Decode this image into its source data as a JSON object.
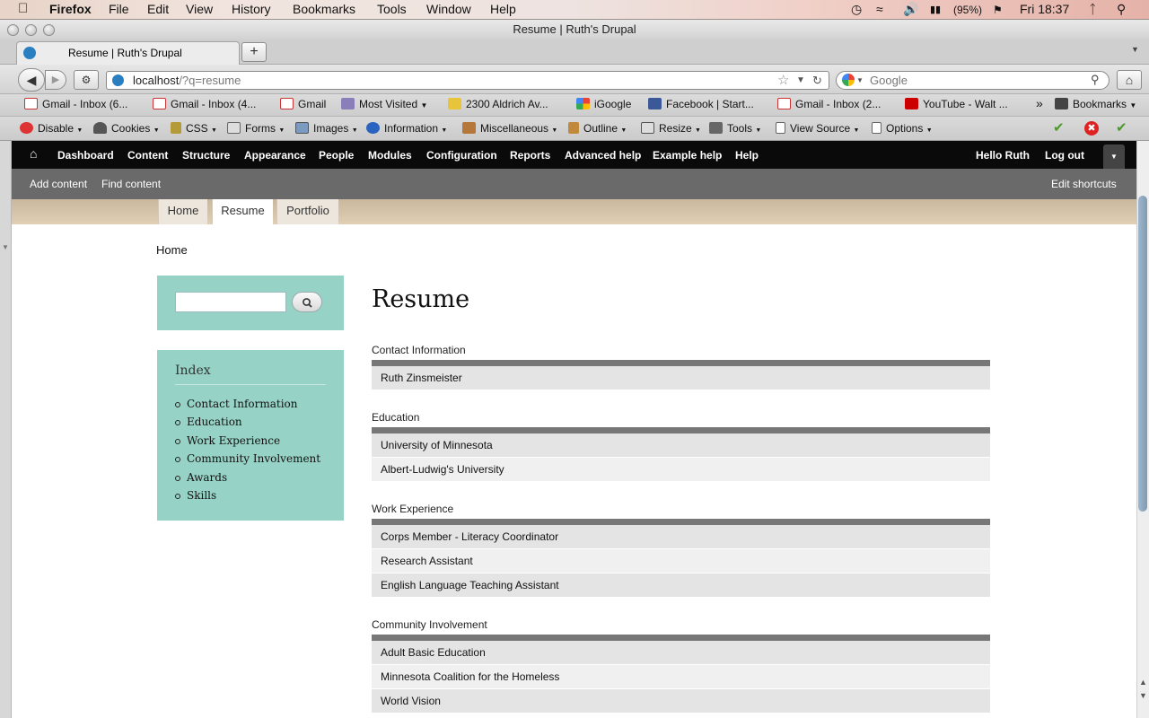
{
  "macmenu": {
    "app": "Firefox",
    "items": [
      "File",
      "Edit",
      "View",
      "History",
      "Bookmarks",
      "Tools",
      "Window",
      "Help"
    ],
    "battery": "(95%)",
    "clock": "Fri 18:37"
  },
  "window": {
    "title": "Resume | Ruth's Drupal"
  },
  "tab": {
    "label": "Resume | Ruth's Drupal",
    "new_tab": "+"
  },
  "urlbar": {
    "host": "localhost",
    "path": "/?q=resume"
  },
  "search": {
    "placeholder": "Google"
  },
  "bookmarks": [
    "Gmail - Inbox (6...",
    "Gmail - Inbox (4...",
    "Gmail",
    "Most Visited",
    "2300 Aldrich Av...",
    "iGoogle",
    "Facebook | Start...",
    "Gmail - Inbox (2...",
    "YouTube - Walt ...",
    "Bookmarks"
  ],
  "bookmarks_overflow": "»",
  "devtools": [
    "Disable",
    "Cookies",
    "CSS",
    "Forms",
    "Images",
    "Information",
    "Miscellaneous",
    "Outline",
    "Resize",
    "Tools",
    "View Source",
    "Options"
  ],
  "toolbar": {
    "items": [
      "Dashboard",
      "Content",
      "Structure",
      "Appearance",
      "People",
      "Modules",
      "Configuration",
      "Reports",
      "Advanced help",
      "Example help",
      "Help"
    ],
    "hello": "Hello Ruth",
    "logout": "Log out"
  },
  "shortcuts": {
    "add": "Add content",
    "find": "Find content",
    "edit": "Edit shortcuts"
  },
  "primary_tabs": [
    "Home",
    "Resume",
    "Portfolio"
  ],
  "breadcrumb": "Home",
  "index": {
    "title": "Index",
    "items": [
      "Contact Information",
      "Education",
      "Work Experience",
      "Community Involvement",
      "Awards",
      "Skills"
    ]
  },
  "page_title": "Resume",
  "sections": [
    {
      "label": "Contact Information",
      "rows": [
        "Ruth Zinsmeister"
      ]
    },
    {
      "label": "Education",
      "rows": [
        "University of Minnesota",
        "Albert-Ludwig's University"
      ]
    },
    {
      "label": "Work Experience",
      "rows": [
        "Corps Member - Literacy Coordinator",
        "Research Assistant",
        "English Language Teaching Assistant"
      ]
    },
    {
      "label": "Community Involvement",
      "rows": [
        "Adult Basic Education",
        "Minnesota Coalition for the Homeless",
        "World Vision"
      ]
    }
  ]
}
